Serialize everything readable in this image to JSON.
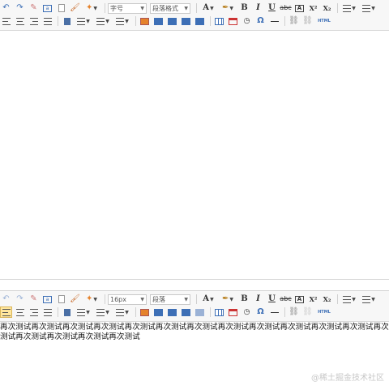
{
  "editor_top": {
    "font_size_select": "字号",
    "paragraph_select": "段落格式"
  },
  "editor_bottom": {
    "font_size_select": "16px",
    "paragraph_select": "段落",
    "content_text": "再次测试再次测试再次测试再次测试再次测试再次测试再次测试再次测试再次测试再次测试再次测试再次测试再次测试再次测试再次测试再次测试再次测试"
  },
  "toolbar_labels": {
    "font_color": "A",
    "bold": "B",
    "italic": "I",
    "underline": "U",
    "strikethrough": "abc",
    "superscript": "X²",
    "subscript": "X₂",
    "omega": "Ω",
    "html_label": "HTML"
  },
  "watermark": "@稀土掘金技术社区",
  "icons": {
    "undo": "undo-icon",
    "redo": "redo-icon",
    "eraser": "eraser-icon",
    "insert-image": "image-icon",
    "table": "table-icon",
    "calendar": "calendar-icon",
    "clock": "clock-icon",
    "link": "link-icon",
    "unlink": "unlink-icon"
  },
  "colors": {
    "toolbar_bg": "#f7f7f7",
    "active_btn": "#ffe69c",
    "icon_blue": "#3d6fb6",
    "icon_red": "#cc3333",
    "icon_orange": "#e5822b"
  }
}
